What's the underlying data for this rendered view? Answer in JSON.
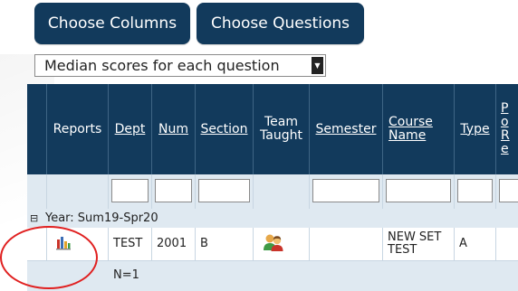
{
  "toolbar": {
    "choose_columns": "Choose Columns",
    "choose_questions": "Choose Questions"
  },
  "report_select": {
    "value": "Median scores for each question"
  },
  "table": {
    "headers": [
      {
        "key": "reports",
        "label": "Reports",
        "link": false
      },
      {
        "key": "dept",
        "label": "Dept",
        "link": true
      },
      {
        "key": "num",
        "label": "Num",
        "link": true
      },
      {
        "key": "section",
        "label": "Section",
        "link": true
      },
      {
        "key": "team_taught",
        "label": "Team Taught",
        "link": false
      },
      {
        "key": "semester",
        "label": "Semester",
        "link": true
      },
      {
        "key": "course_name",
        "label": "Course Name",
        "link": true
      },
      {
        "key": "type",
        "label": "Type",
        "link": true
      },
      {
        "key": "po_re",
        "label": "Po Re",
        "link": true
      }
    ],
    "group": {
      "toggle": "⊟",
      "label": "Year: Sum19-Spr20"
    },
    "row": {
      "dept": "TEST",
      "num": "2001",
      "section": "B",
      "course_name": "NEW SET TEST",
      "type": "A"
    },
    "count": "N=1"
  },
  "colors": {
    "header_bg": "#123a5c",
    "row_alt_bg": "#dfe9f1",
    "highlight_circle": "#e02020"
  },
  "icons": {
    "reports": "bar-chart-icon",
    "team_taught": "two-people-icon"
  }
}
